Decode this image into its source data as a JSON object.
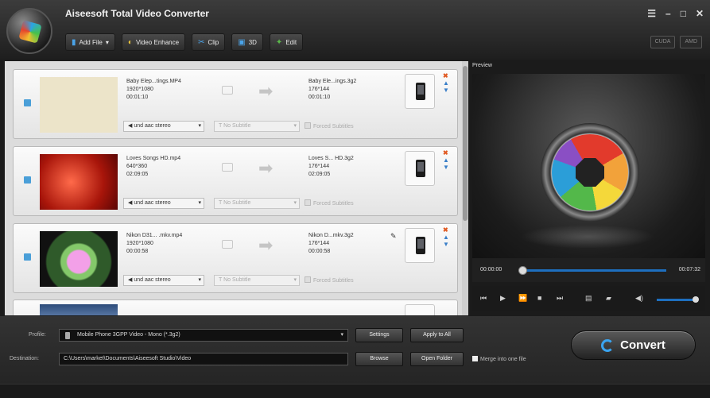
{
  "app": {
    "title": "Aiseesoft Total Video Converter"
  },
  "toolbar": {
    "add_file": "Add File",
    "video_enhance": "Video Enhance",
    "clip": "Clip",
    "three_d": "3D",
    "edit": "Edit"
  },
  "window_controls": {
    "menu": "☰",
    "minimize": "–",
    "maximize": "□",
    "close": "✕"
  },
  "accel": {
    "cuda": "CUDA",
    "amd": "AMD"
  },
  "items": [
    {
      "src_name": "Baby Elep...tings.MP4",
      "src_res": "1920*1080",
      "src_dur": "00:01:10",
      "dst_name": "Baby Ele...ings.3g2",
      "dst_res": "176*144",
      "dst_dur": "00:01:10"
    },
    {
      "src_name": "Loves Songs HD.mp4",
      "src_res": "640*360",
      "src_dur": "02:09:05",
      "dst_name": "Loves S... HD.3g2",
      "dst_res": "176*144",
      "dst_dur": "02:09:05"
    },
    {
      "src_name": "Nikon D31... .mkv.mp4",
      "src_res": "1920*1080",
      "src_dur": "00:00:58",
      "dst_name": "Nikon D...mkv.3g2",
      "dst_res": "176*144",
      "dst_dur": "00:00:58"
    }
  ],
  "item_common": {
    "audio": "und aac stereo",
    "subtitle": "No Subtitle",
    "forced": "Forced Subtitles"
  },
  "preview": {
    "label": "Preview",
    "time_start": "00:00:00",
    "time_end": "00:07:32",
    "volume_fraction": 0.9
  },
  "bottom": {
    "profile_label": "Profile:",
    "profile_value": "Mobile Phone 3GPP Video - Mono (*.3g2)",
    "settings": "Settings",
    "apply_all": "Apply to All",
    "destination_label": "Destination:",
    "destination_value": "C:\\Users\\market\\Documents\\Aiseesoft Studio\\Video",
    "browse": "Browse",
    "open_folder": "Open Folder",
    "merge": "Merge into one file",
    "convert": "Convert"
  }
}
